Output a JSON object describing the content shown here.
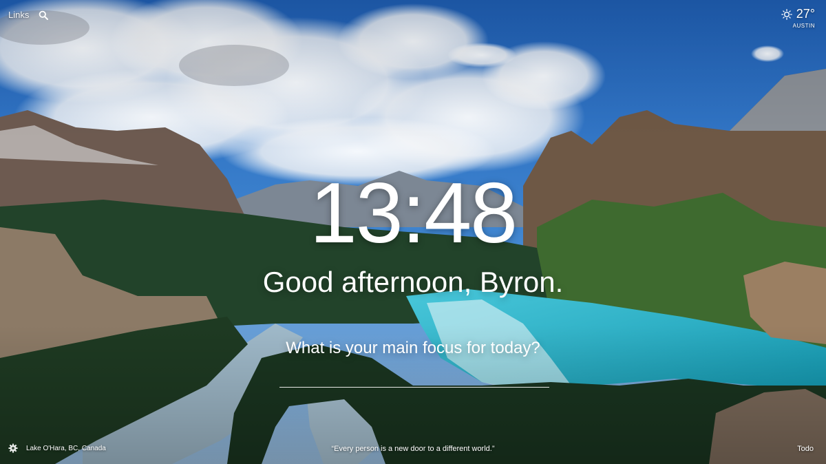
{
  "background": {
    "sky_top": "#1f5fb5",
    "lake_turquoise": "#1fb3c8",
    "forest": "#1c3a1e"
  },
  "topbar": {
    "links_label": "Links",
    "search_icon": "search-icon"
  },
  "weather": {
    "icon": "sun-icon",
    "temperature": "27°",
    "location": "AUSTIN"
  },
  "clock": {
    "time": "13:48"
  },
  "greeting": {
    "text": "Good afternoon, Byron."
  },
  "focus": {
    "prompt": "What is your main focus for today?",
    "input_value": ""
  },
  "footer": {
    "settings_icon": "gear-icon",
    "photo_location": "Lake O'Hara, BC, Canada",
    "quote": "“Every person is a new door to a different world.”",
    "todo_label": "Todo"
  }
}
